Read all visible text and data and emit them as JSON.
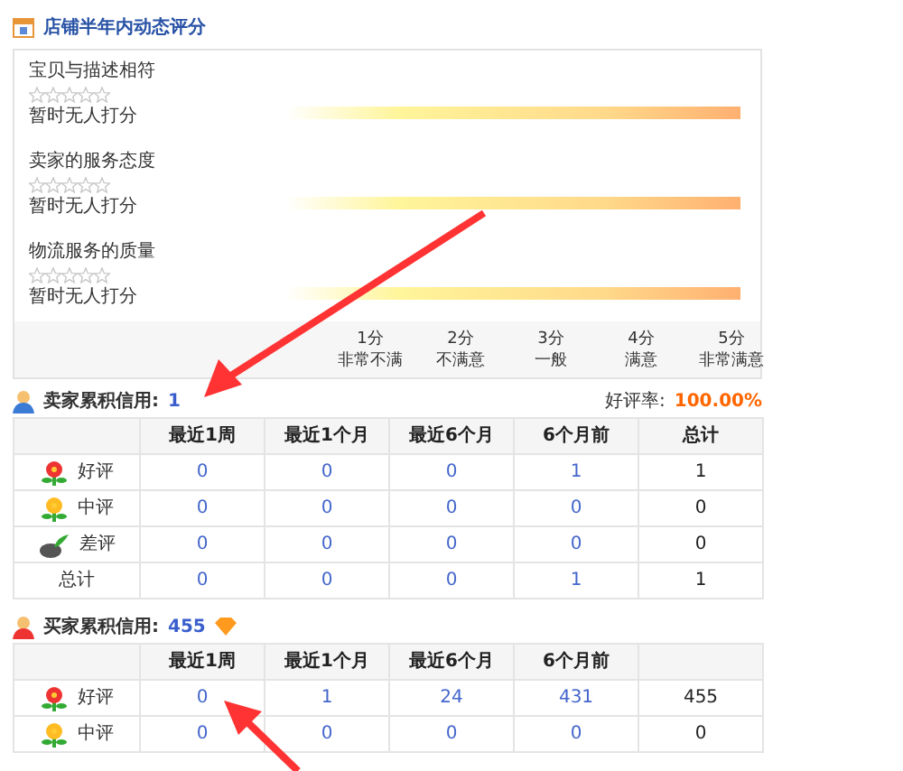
{
  "section_title": "店铺半年内动态评分",
  "ratings": [
    {
      "label": "宝贝与描述相符",
      "stars": 0,
      "status": "暂时无人打分"
    },
    {
      "label": "卖家的服务态度",
      "stars": 0,
      "status": "暂时无人打分"
    },
    {
      "label": "物流服务的质量",
      "stars": 0,
      "status": "暂时无人打分"
    }
  ],
  "scale": [
    {
      "score": "1分",
      "meaning": "非常不满"
    },
    {
      "score": "2分",
      "meaning": "不满意"
    },
    {
      "score": "3分",
      "meaning": "一般"
    },
    {
      "score": "4分",
      "meaning": "满意"
    },
    {
      "score": "5分",
      "meaning": "非常满意"
    }
  ],
  "seller": {
    "label": "卖家累积信用:",
    "value": "1",
    "rate_label": "好评率:",
    "rate": "100.00%",
    "columns": [
      "最近1周",
      "最近1个月",
      "最近6个月",
      "6个月前",
      "总计"
    ],
    "rows": [
      {
        "kind": "good",
        "label": "好评",
        "cells": [
          "0",
          "0",
          "0",
          "1",
          "1"
        ]
      },
      {
        "kind": "neutral",
        "label": "中评",
        "cells": [
          "0",
          "0",
          "0",
          "0",
          "0"
        ]
      },
      {
        "kind": "bad",
        "label": "差评",
        "cells": [
          "0",
          "0",
          "0",
          "0",
          "0"
        ]
      },
      {
        "kind": "total",
        "label": "总计",
        "cells": [
          "0",
          "0",
          "0",
          "1",
          "1"
        ]
      }
    ]
  },
  "buyer": {
    "label": "买家累积信用:",
    "value": "455",
    "columns": [
      "最近1周",
      "最近1个月",
      "最近6个月",
      "6个月前"
    ],
    "rows": [
      {
        "kind": "good",
        "label": "好评",
        "cells": [
          "0",
          "1",
          "24",
          "431",
          "455"
        ]
      },
      {
        "kind": "neutral",
        "label": "中评",
        "cells": [
          "0",
          "0",
          "0",
          "0",
          "0"
        ]
      }
    ]
  }
}
